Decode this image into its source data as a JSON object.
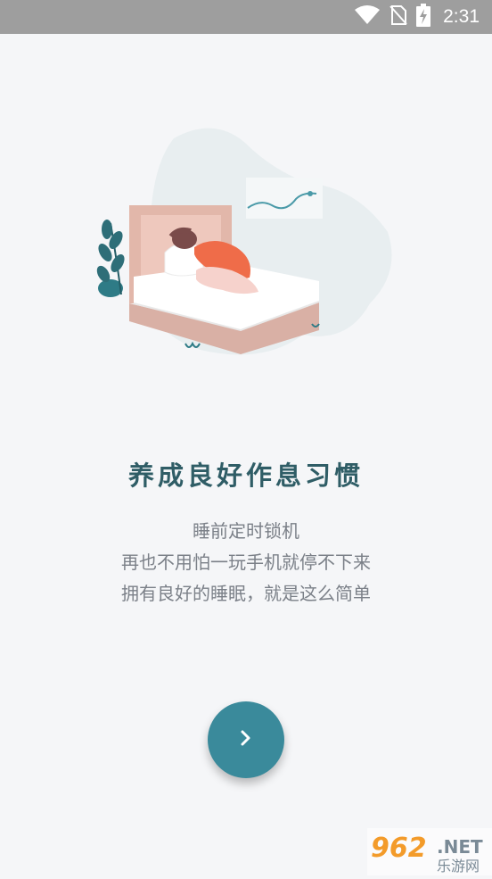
{
  "status_bar": {
    "time": "2:31",
    "icons": [
      "wifi-icon",
      "no-sim-icon",
      "battery-charging-icon"
    ]
  },
  "onboarding": {
    "title": "养成良好作息习惯",
    "description_lines": [
      "睡前定时锁机",
      "再也不用怕一玩手机就停不下来",
      "拥有良好的睡眠，就是这么简单"
    ],
    "next_icon": "chevron-right-icon"
  },
  "watermark": {
    "number": "962",
    "suffix": ".NET",
    "subtitle": "乐游网"
  },
  "colors": {
    "status_bar": "#9e9e9e",
    "background": "#f5f6f8",
    "title": "#2f5d66",
    "description": "#7b8088",
    "accent_button": "#3a8a9b"
  }
}
